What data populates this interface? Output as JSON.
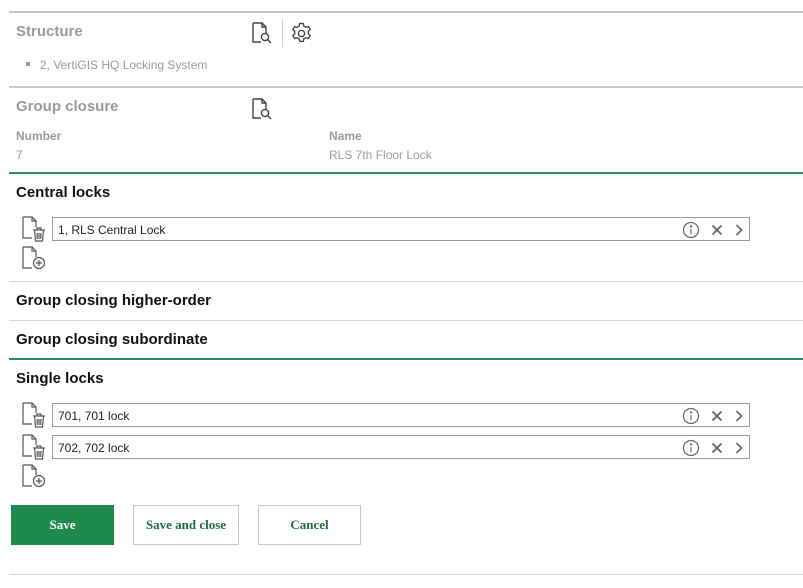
{
  "structure": {
    "title": "Structure",
    "items": [
      "2, VertiGIS HQ Locking System"
    ]
  },
  "group_closure": {
    "title": "Group closure",
    "number_label": "Number",
    "number_value": "7",
    "name_label": "Name",
    "name_value": "RLS 7th Floor Lock"
  },
  "central_locks": {
    "title": "Central locks",
    "items": [
      "1, RLS Central Lock"
    ]
  },
  "group_higher": {
    "title": "Group closing higher-order"
  },
  "group_subordinate": {
    "title": "Group closing subordinate"
  },
  "single_locks": {
    "title": "Single locks",
    "items": [
      "701, 701 lock",
      "702, 702 lock"
    ]
  },
  "buttons": {
    "save": "Save",
    "save_and_close": "Save and close",
    "cancel": "Cancel"
  },
  "colors": {
    "accent": "#1e8a4c",
    "divider_green": "#2e8b57",
    "muted_text": "#9a9a9a"
  },
  "icons": {
    "search_document": "document-search-icon",
    "settings": "gear-icon",
    "delete_document": "document-trash-icon",
    "add_document": "document-add-icon",
    "info": "info-icon",
    "remove": "close-icon",
    "navigate": "chevron-right-icon"
  }
}
